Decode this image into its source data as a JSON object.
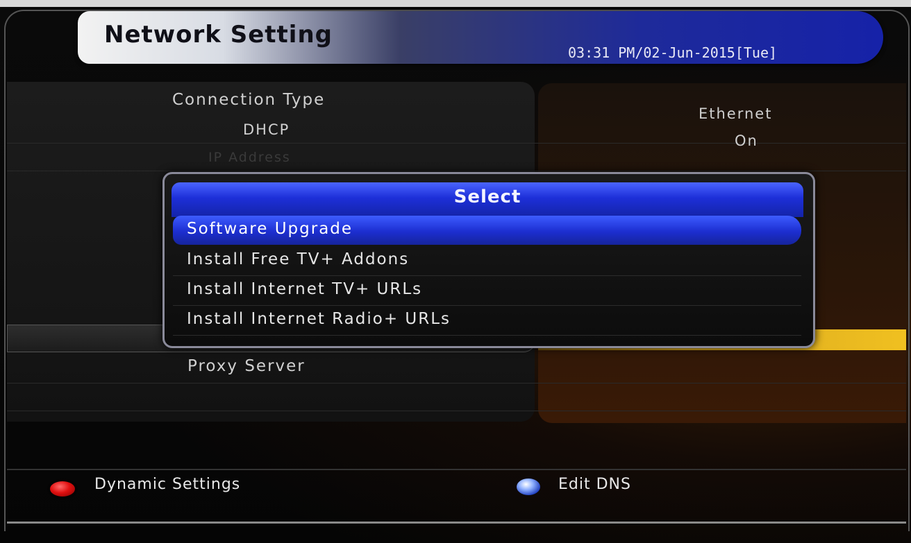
{
  "header": {
    "title": "Network Setting",
    "clock": "03:31 PM/02-Jun-2015[Tue]"
  },
  "settings": {
    "rows": [
      {
        "label": "Connection Type",
        "value": "Ethernet"
      },
      {
        "label": "DHCP",
        "value": "On"
      },
      {
        "label": "IP Address",
        "value": ""
      }
    ],
    "proxy_label": "Proxy Server"
  },
  "dialog": {
    "title": "Select",
    "options": [
      {
        "label": "Software Upgrade",
        "selected": true
      },
      {
        "label": "Install Free TV+ Addons",
        "selected": false
      },
      {
        "label": "Install Internet TV+ URLs",
        "selected": false
      },
      {
        "label": "Install Internet Radio+ URLs",
        "selected": false
      }
    ]
  },
  "footer": {
    "red_label": "Dynamic Settings",
    "red_icon": "red-button-icon",
    "blue_label": "Edit DNS",
    "blue_icon": "blue-button-icon"
  },
  "colors": {
    "accent_blue": "#1d2fd8",
    "highlight_gold": "#d8a820",
    "red_key": "#e01010"
  }
}
